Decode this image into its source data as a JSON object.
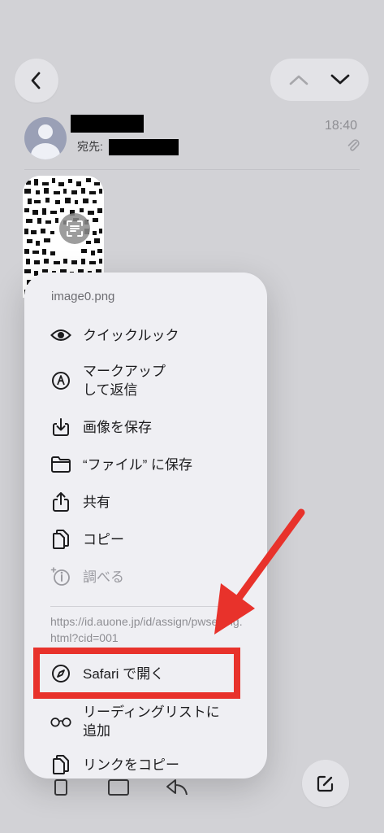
{
  "header": {
    "to_label": "宛先:",
    "time": "18:40"
  },
  "menu": {
    "title": "image0.png",
    "items": [
      {
        "icon": "eye-icon",
        "label": "クイックルック"
      },
      {
        "icon": "markup-icon",
        "label": "マークアップ\nして返信"
      },
      {
        "icon": "save-image-icon",
        "label": "画像を保存"
      },
      {
        "icon": "folder-icon",
        "label": "“ファイル” に保存"
      },
      {
        "icon": "share-icon",
        "label": "共有"
      },
      {
        "icon": "copy-icon",
        "label": "コピー"
      },
      {
        "icon": "lookup-icon",
        "label": "調べる"
      }
    ],
    "url": "https://id.auone.jp/id/assign/pwsetting.html?cid=001",
    "link_items": [
      {
        "icon": "safari-compass-icon",
        "label": "Safari で開く"
      },
      {
        "icon": "reading-glasses-icon",
        "label": "リーディングリストに\n追加"
      },
      {
        "icon": "copy-icon",
        "label": "リンクをコピー"
      }
    ]
  },
  "colors": {
    "annotation": "#e8322b",
    "menu_bg": "#efeff3"
  }
}
